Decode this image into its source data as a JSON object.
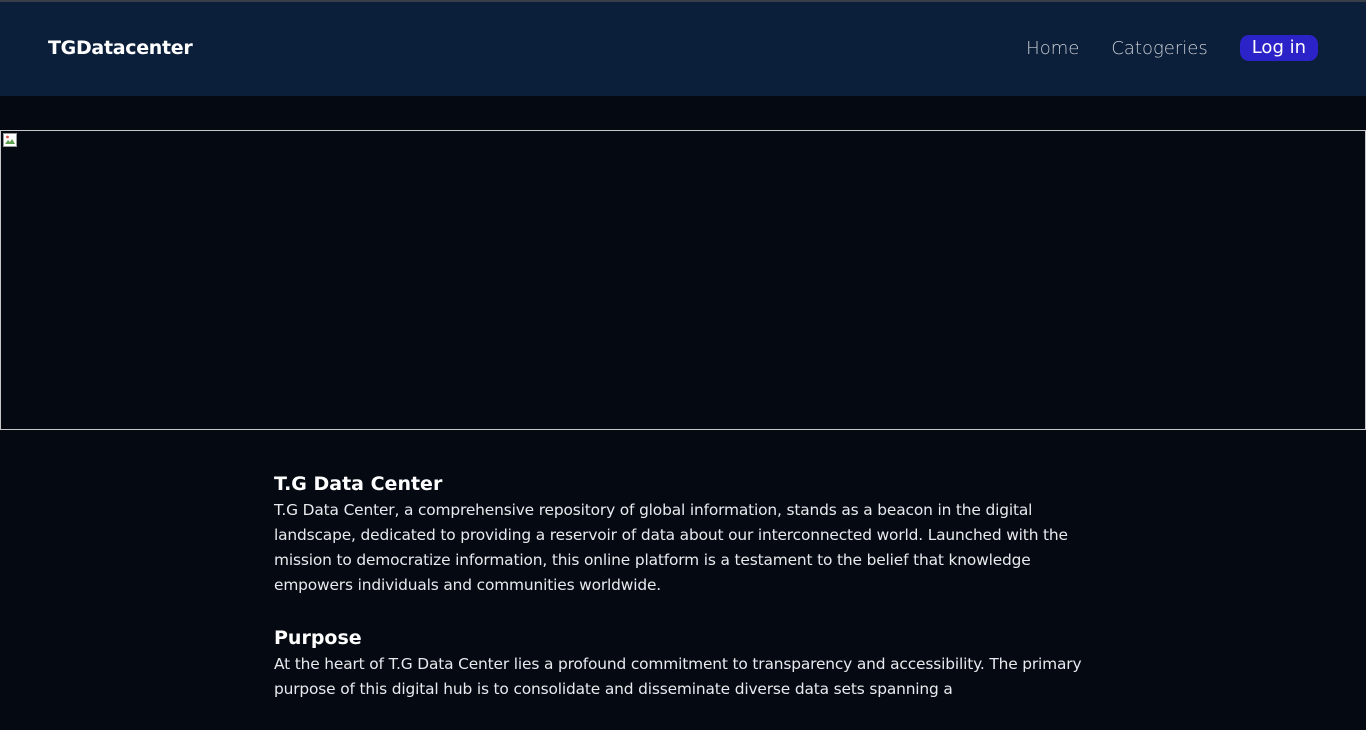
{
  "header": {
    "brand": "TGDatacenter",
    "nav": {
      "home": "Home",
      "categories": "Catogeries",
      "login": "Log in"
    }
  },
  "hero": {
    "icon": "broken-image-icon"
  },
  "sections": [
    {
      "title": "T.G Data Center",
      "text": "T.G Data Center, a comprehensive repository of global information, stands as a beacon in the digital landscape, dedicated to providing a reservoir of data about our interconnected world. Launched with the mission to democratize information, this online platform is a testament to the belief that knowledge empowers individuals and communities worldwide."
    },
    {
      "title": "Purpose",
      "text": "At the heart of T.G Data Center lies a profound commitment to transparency and accessibility. The primary purpose of this digital hub is to consolidate and disseminate diverse data sets spanning a"
    }
  ],
  "colors": {
    "page_background": "#050911",
    "navbar_background": "#0b1f3a",
    "login_button": "#2b22c7"
  }
}
